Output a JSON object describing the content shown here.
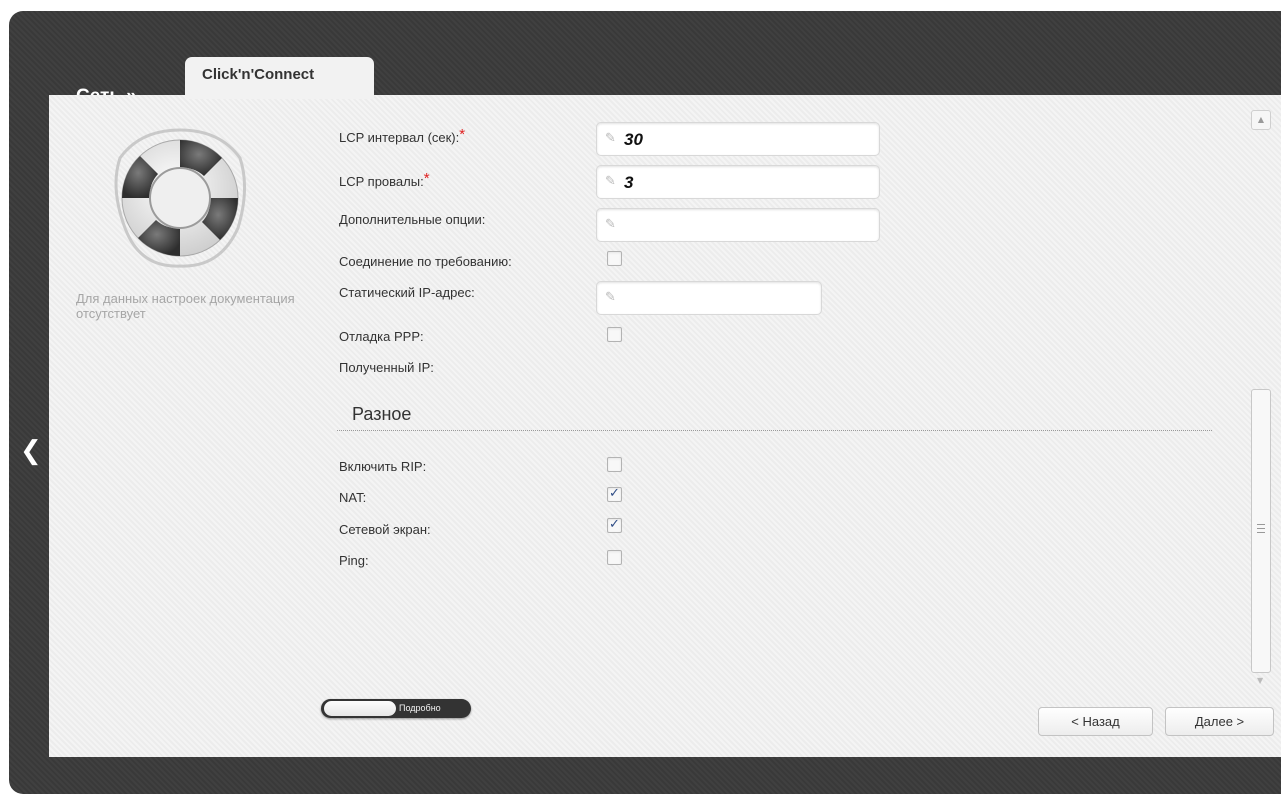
{
  "header": {
    "section": "Сеть »",
    "tab": "Click'n'Connect"
  },
  "help": {
    "text": "Для данных настроек документация отсутствует",
    "icon": "lifebuoy-icon"
  },
  "fields": {
    "lcp_interval": {
      "label": "LCP интервал (сек):",
      "required": "*",
      "value": "30"
    },
    "lcp_failures": {
      "label": "LCP провалы:",
      "required": "*",
      "value": "3"
    },
    "extra_options": {
      "label": "Дополнительные опции:",
      "value": ""
    },
    "on_demand": {
      "label": "Соединение по требованию:",
      "checked": false
    },
    "static_ip": {
      "label": "Статический IP-адрес:",
      "value": ""
    },
    "ppp_debug": {
      "label": "Отладка PPP:",
      "checked": false
    },
    "received_ip": {
      "label": "Полученный IP:",
      "value": ""
    }
  },
  "misc": {
    "title": "Разное",
    "rip": {
      "label": "Включить RIP:",
      "checked": false
    },
    "nat": {
      "label": "NAT:",
      "checked": true
    },
    "firewall": {
      "label": "Сетевой экран:",
      "checked": true
    },
    "ping": {
      "label": "Ping:",
      "checked": false
    }
  },
  "footer": {
    "toggle_label": "Подробно",
    "back_label": "< Назад",
    "next_label": "Далее >"
  },
  "colors": {
    "frame": "#3b3b3b",
    "panel": "#efefef",
    "required": "#e02020",
    "check": "#2f4d86"
  }
}
